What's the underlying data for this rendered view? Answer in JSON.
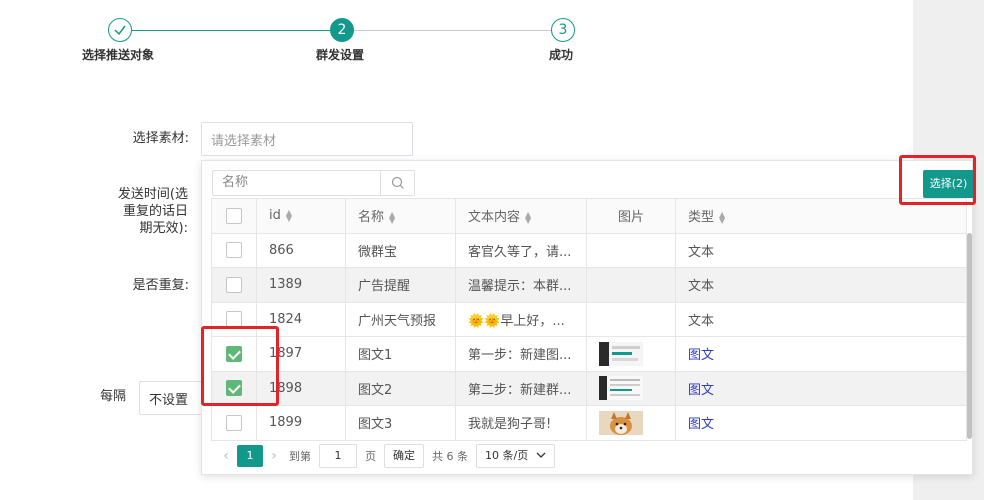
{
  "steps": [
    {
      "label": "选择推送对象",
      "icon": "check-icon",
      "status": "done"
    },
    {
      "label": "群发设置",
      "number": "2",
      "status": "active"
    },
    {
      "label": "成功",
      "number": "3",
      "status": "pending"
    }
  ],
  "form": {
    "material_label": "选择素材:",
    "material_placeholder": "请选择素材",
    "send_time_label": "发送时间(选重复的话日期无效):",
    "repeat_label": "是否重复:",
    "every_label": "每隔",
    "every_value": "不设置"
  },
  "picker": {
    "search_placeholder": "名称",
    "select_button": "选择(2)",
    "columns": [
      "id",
      "名称",
      "文本内容",
      "图片",
      "类型"
    ],
    "rows": [
      {
        "checked": false,
        "id": "866",
        "name": "微群宝",
        "content": "客官久等了，请...",
        "image": "",
        "type": "文本"
      },
      {
        "checked": false,
        "id": "1389",
        "name": "广告提醒",
        "content": "温馨提示：本群...",
        "image": "",
        "type": "文本"
      },
      {
        "checked": false,
        "id": "1824",
        "name": "广州天气预报",
        "content": "🌞🌞早上好，...",
        "image": "",
        "type": "文本"
      },
      {
        "checked": true,
        "id": "1897",
        "name": "图文1",
        "content": "第一步：新建图...",
        "image": "screenshot-thumb",
        "type": "图文"
      },
      {
        "checked": true,
        "id": "1898",
        "name": "图文2",
        "content": "第二步：新建群...",
        "image": "screenshot-thumb",
        "type": "图文"
      },
      {
        "checked": false,
        "id": "1899",
        "name": "图文3",
        "content": "我就是狗子哥!",
        "image": "dog-thumb",
        "type": "图文"
      }
    ],
    "pagination": {
      "prev": "‹",
      "current": "1",
      "next": "›",
      "goto_label": "到第",
      "goto_value": "1",
      "page_unit": "页",
      "confirm": "确定",
      "total": "共 6 条",
      "page_size": "10 条/页"
    }
  },
  "colors": {
    "primary": "#13998c",
    "checked": "#5fb878",
    "text_type": "#2fb838",
    "news_type": "#2b3cbf",
    "highlight": "#e2232a"
  }
}
